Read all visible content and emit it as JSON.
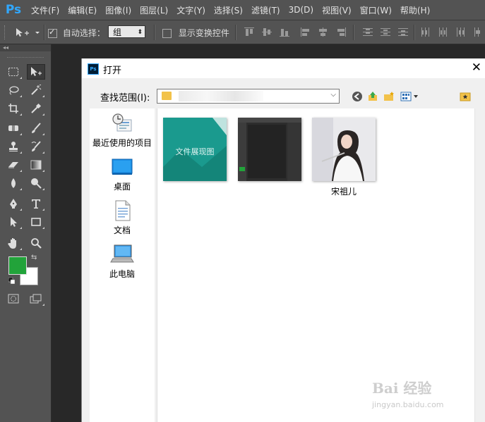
{
  "app": {
    "logo": "Ps"
  },
  "menu": [
    "文件(F)",
    "编辑(E)",
    "图像(I)",
    "图层(L)",
    "文字(Y)",
    "选择(S)",
    "滤镜(T)",
    "3D(D)",
    "视图(V)",
    "窗口(W)",
    "帮助(H)"
  ],
  "options": {
    "auto_select_label": "自动选择：",
    "auto_select_checked": true,
    "auto_select_target": "组",
    "show_transform_label": "显示变换控件",
    "show_transform_checked": false
  },
  "toolbox": {
    "collapse": "◂◂",
    "foreground_color": "#22a33a",
    "background_color": "#ffffff",
    "tools": [
      "marquee-icon",
      "move-icon",
      "lasso-icon",
      "magic-wand-icon",
      "crop-icon",
      "eyedropper-icon",
      "spot-healing-icon",
      "brush-icon",
      "clone-stamp-icon",
      "history-brush-icon",
      "eraser-icon",
      "gradient-icon",
      "blur-icon",
      "dodge-icon",
      "pen-icon",
      "type-icon",
      "path-selection-icon",
      "rectangle-icon",
      "hand-icon",
      "zoom-icon"
    ]
  },
  "dialog": {
    "title": "打开",
    "close": "✕",
    "look_in_label": "查找范围(I):",
    "places": [
      {
        "label": "最近使用的项目",
        "icon": "recent-items-icon"
      },
      {
        "label": "桌面",
        "icon": "desktop-icon"
      },
      {
        "label": "文档",
        "icon": "documents-icon"
      },
      {
        "label": "此电脑",
        "icon": "this-pc-icon"
      }
    ],
    "files": [
      {
        "label": "",
        "thumb_text": "文件展现图"
      },
      {
        "label": ""
      },
      {
        "label": "宋祖儿"
      }
    ]
  },
  "watermark": {
    "brand": "Bai 经验",
    "url": "jingyan.baidu.com"
  }
}
